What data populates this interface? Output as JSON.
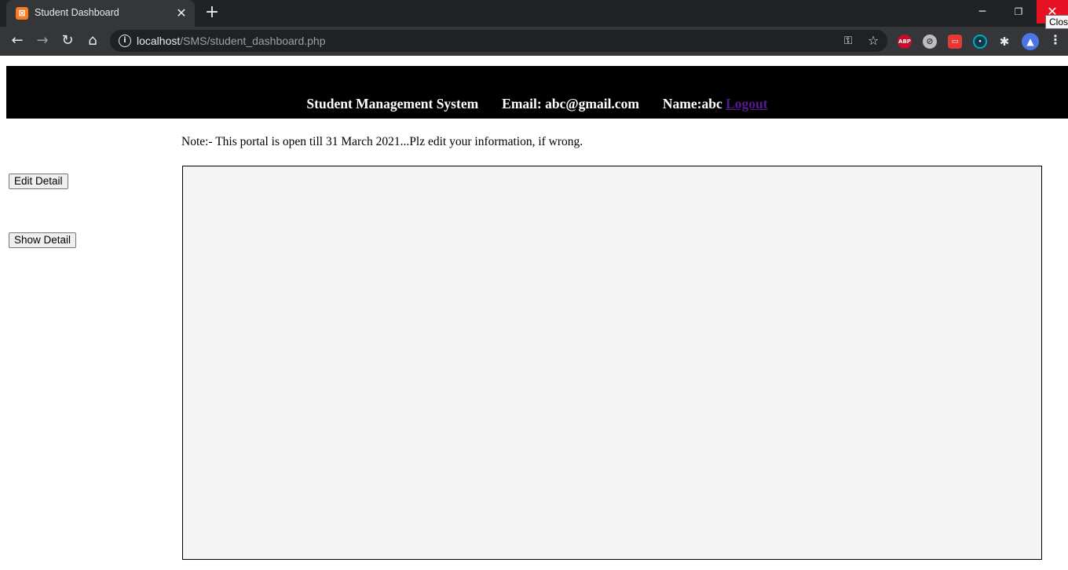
{
  "browser": {
    "tab_title": "Student Dashboard",
    "tab_favicon": "xampp-icon",
    "tooltip": "Close",
    "url_host": "localhost",
    "url_path": "/SMS/student_dashboard.php",
    "extensions": {
      "abp_label": "ABP"
    }
  },
  "header": {
    "title": "Student Management System",
    "email": "Email: abc@gmail.com",
    "name": "Name:abc",
    "logout": "Logout"
  },
  "note": "Note:- This portal is open till 31 March 2021...Plz edit your information, if wrong.",
  "sidebar": {
    "edit_button": "Edit Detail",
    "show_button": "Show Detail"
  },
  "colors": {
    "header_bg": "#000000",
    "link": "#551a8b",
    "frame_bg": "#f4f4f4"
  }
}
